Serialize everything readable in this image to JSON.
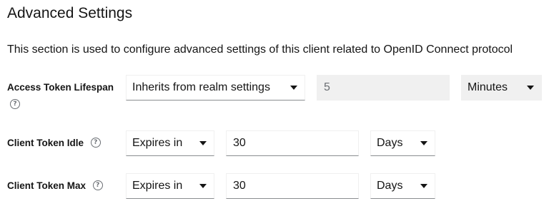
{
  "section": {
    "title": "Advanced Settings",
    "description": "This section is used to configure advanced settings of this client related to OpenID Connect protocol"
  },
  "rows": {
    "access_token_lifespan": {
      "label": "Access Token Lifespan",
      "help_icon": "question-circle-icon",
      "mode": "Inherits from realm settings",
      "value": "5",
      "unit": "Minutes",
      "disabled": true
    },
    "client_token_idle": {
      "label": "Client Token Idle",
      "help_icon": "question-circle-icon",
      "mode": "Expires in",
      "value": "30",
      "unit": "Days"
    },
    "client_token_max": {
      "label": "Client Token Max",
      "help_icon": "question-circle-icon",
      "mode": "Expires in",
      "value": "30",
      "unit": "Days"
    }
  },
  "glyphs": {
    "help": "?"
  },
  "colors": {
    "text": "#151515",
    "muted": "#6a6e73",
    "disabled_bg": "#f0f0f0",
    "border_bottom": "#8a8d90"
  }
}
